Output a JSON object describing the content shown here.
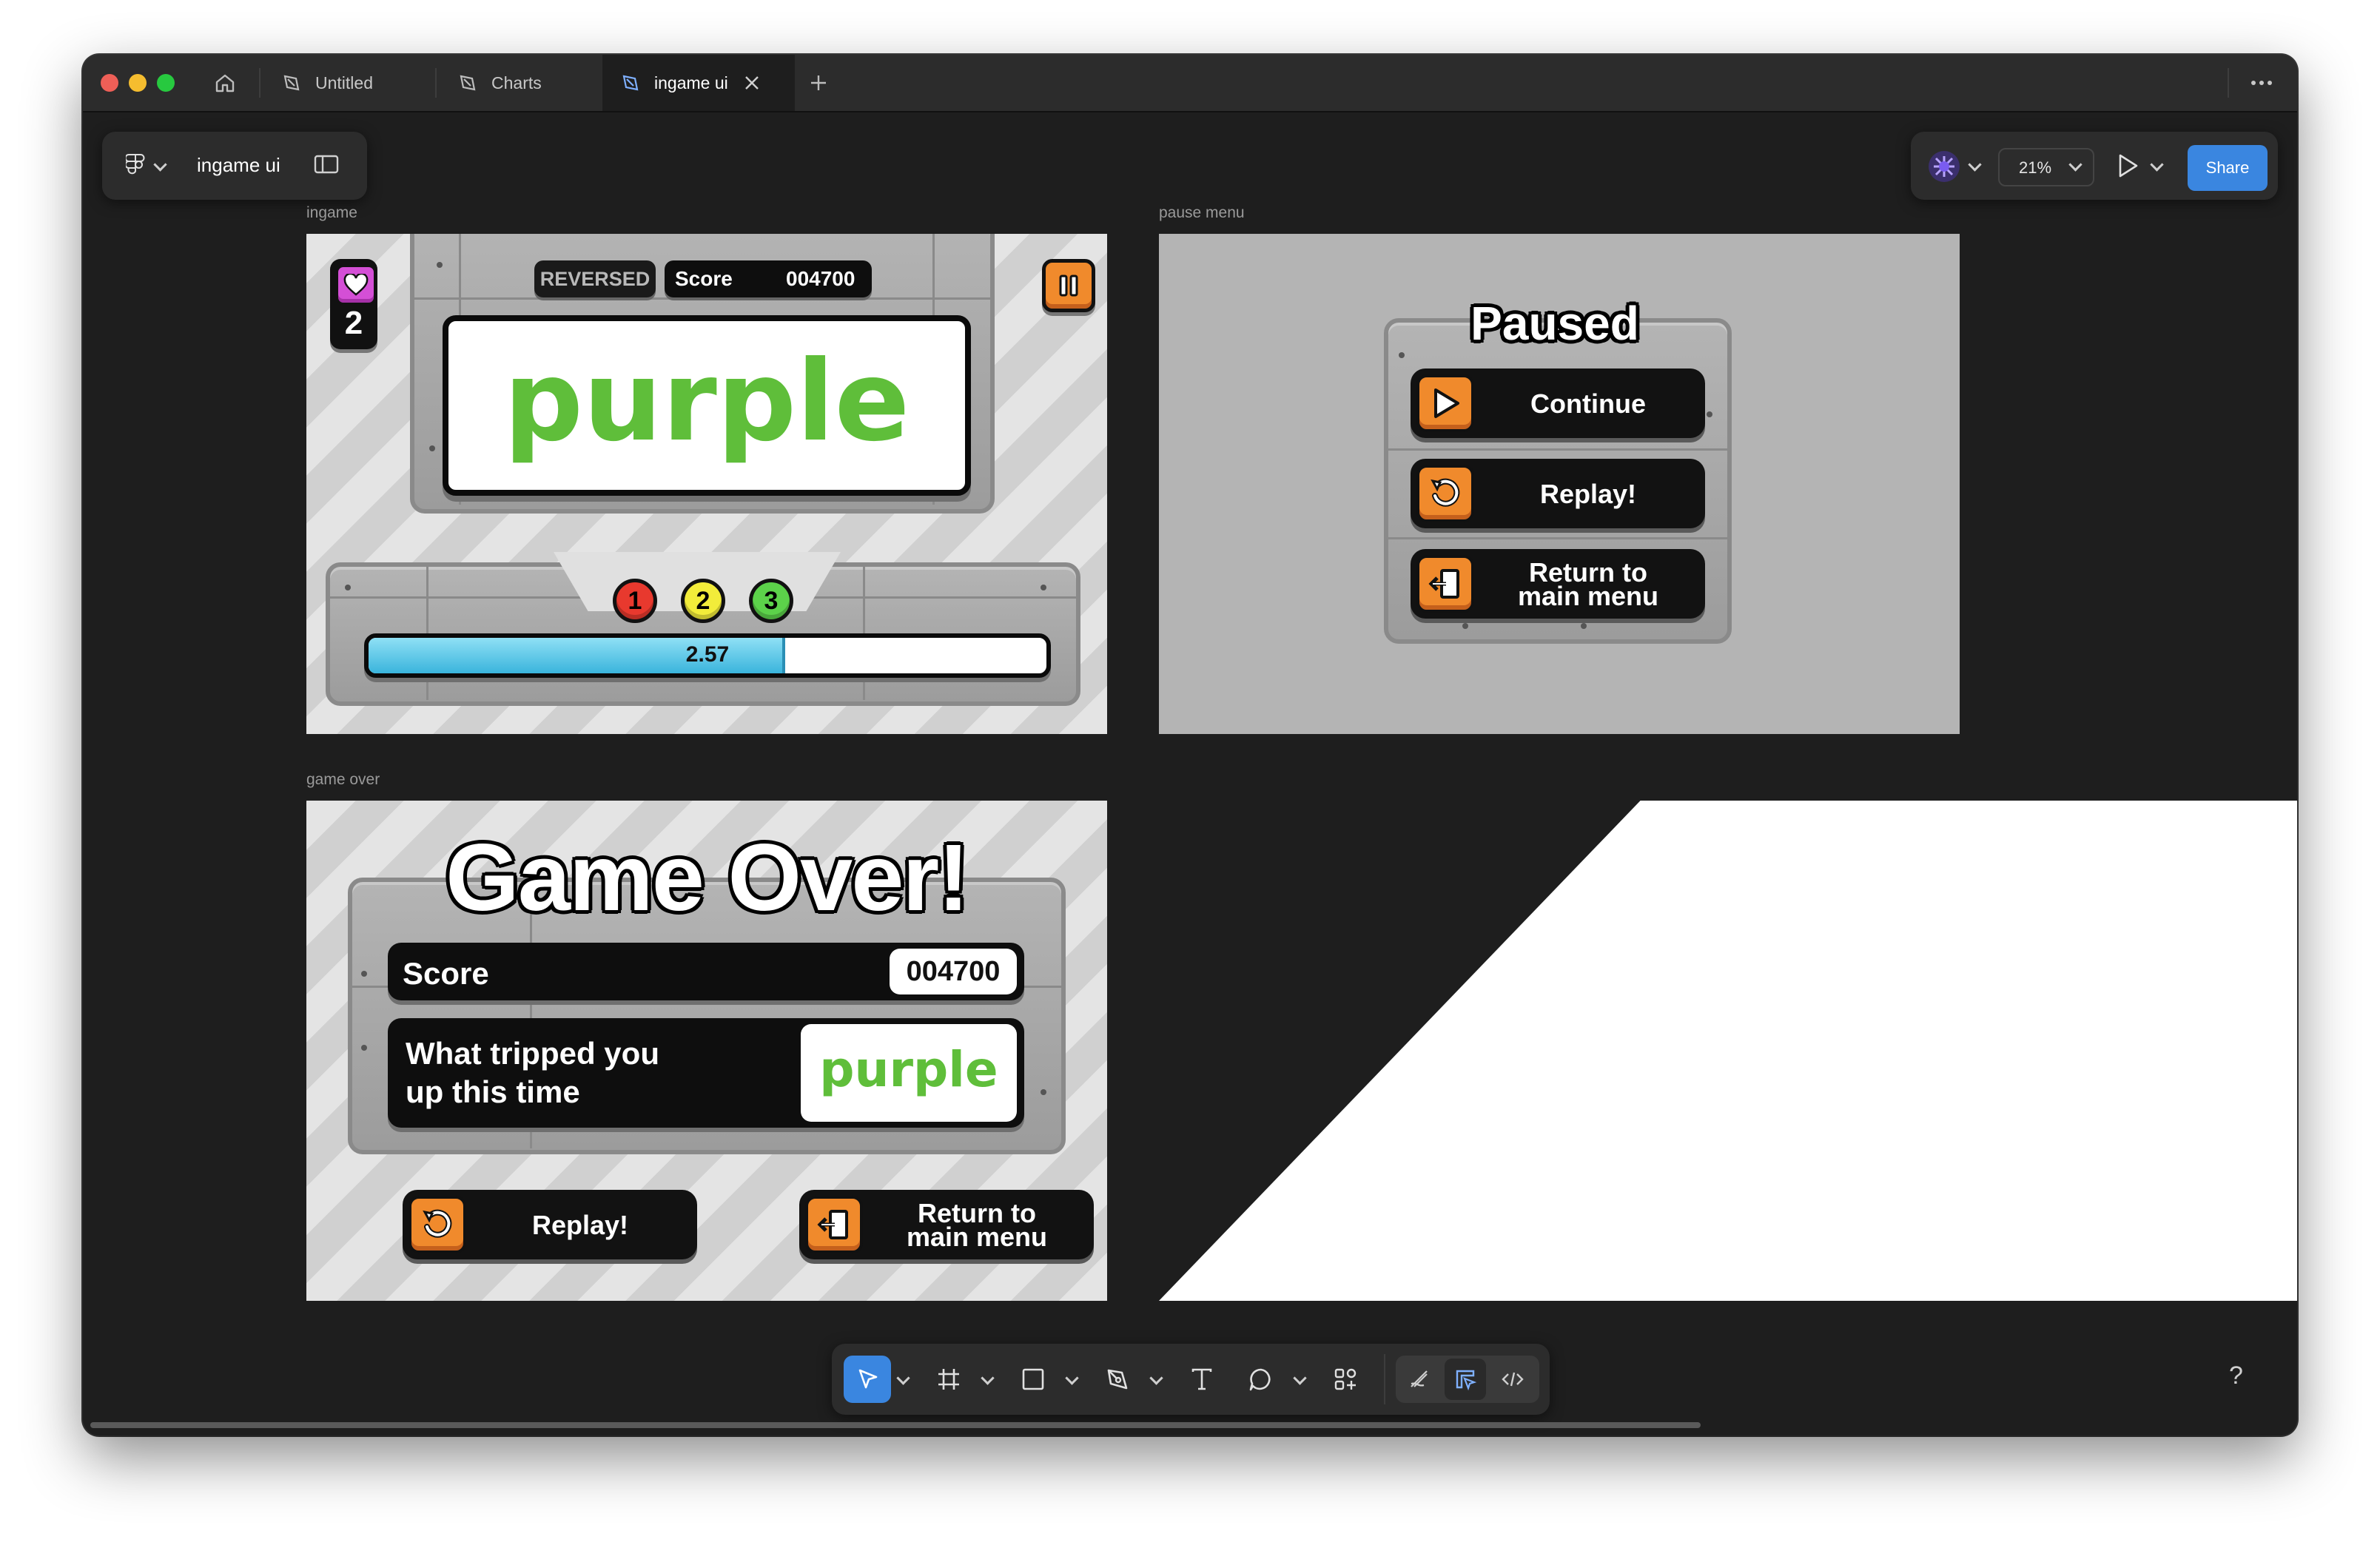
{
  "tabs": [
    {
      "label": "Untitled"
    },
    {
      "label": "Charts"
    },
    {
      "label": "ingame ui"
    }
  ],
  "file": {
    "name": "ingame ui"
  },
  "toolbar_right": {
    "zoom": "21%",
    "share_label": "Share"
  },
  "frames": {
    "ingame": {
      "label": "ingame",
      "reversed_badge": "REVERSED",
      "score_label": "Score",
      "score_value": "004700",
      "lives": "2",
      "word": "purple",
      "choices": [
        "1",
        "2",
        "3"
      ],
      "choice_colors": [
        "#e8392e",
        "#f2ec3a",
        "#5cd24a"
      ],
      "timer_value": "2.57",
      "timer_progress": 0.61
    },
    "pause_menu": {
      "label": "pause menu",
      "title": "Paused",
      "continue_label": "Continue",
      "replay_label": "Replay!",
      "return_line1": "Return to",
      "return_line2": "main menu"
    },
    "game_over": {
      "label": "game over",
      "title": "Game Over!",
      "score_label": "Score",
      "score_value": "004700",
      "tripped_line1": "What tripped you",
      "tripped_line2": "up this time",
      "word": "purple",
      "replay_label": "Replay!",
      "return_line1": "Return to",
      "return_line2": "main menu"
    }
  },
  "bottom_toolbar": {
    "tools": [
      "move-tool",
      "frame-tool",
      "shape-tool",
      "pen-tool",
      "text-tool",
      "comment-tool",
      "actions-tool"
    ],
    "modes": [
      "draw-mode",
      "design-mode",
      "dev-mode"
    ]
  },
  "help_label": "?",
  "colors": {
    "accent": "#3a86e0",
    "canvas": "#1e1e1e",
    "orange": "#f08a2c",
    "timer_blue": "#4cc0e6",
    "green_word": "#5fbe3a",
    "heart_pink": "#d44fd6"
  }
}
